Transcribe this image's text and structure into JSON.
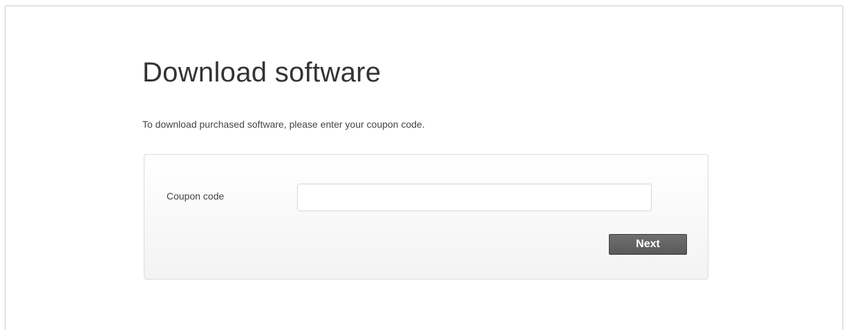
{
  "page": {
    "title": "Download software",
    "intro": "To download purchased software, please enter your coupon code."
  },
  "form": {
    "coupon_label": "Coupon code",
    "coupon_value": "",
    "coupon_placeholder": "",
    "next_label": "Next"
  },
  "colors": {
    "title_text": "#333333",
    "body_text": "#444444",
    "panel_border": "#dcdcdc",
    "button_background": "#5f5f5f",
    "button_text": "#ffffff"
  }
}
